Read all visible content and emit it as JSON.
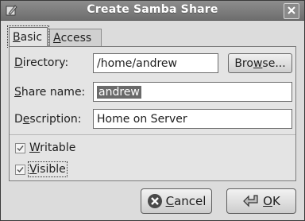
{
  "window": {
    "title": "Create Samba Share"
  },
  "tabs": [
    {
      "label_u": "B",
      "label_rest": "asic",
      "active": true
    },
    {
      "label_u": "A",
      "label_rest": "ccess",
      "active": false
    }
  ],
  "form": {
    "directory": {
      "label_u": "D",
      "label_rest": "irectory:",
      "value": "/home/andrew"
    },
    "browse_u": "w",
    "browse_pre": "Bro",
    "browse_post": "se...",
    "share_name": {
      "label_u": "S",
      "label_rest": "hare name:",
      "value": "andrew"
    },
    "description": {
      "label_pre": "D",
      "label_u": "e",
      "label_rest": "scription:",
      "value": "Home on Server"
    },
    "writable": {
      "label_u": "W",
      "label_rest": "ritable",
      "checked": true
    },
    "visible": {
      "label_u": "V",
      "label_rest": "isible",
      "checked": true
    }
  },
  "buttons": {
    "cancel": {
      "label_u": "C",
      "label_rest": "ancel"
    },
    "ok": {
      "label_u": "O",
      "label_rest": "K"
    }
  },
  "icons": {
    "app": "samba-share-icon",
    "close": "close-icon",
    "cancel": "cancel-icon",
    "ok": "ok-arrow-icon",
    "check": "checkmark-icon"
  },
  "colors": {
    "titlebar": "#7d7d7d",
    "selection": "#6a6a6a"
  }
}
